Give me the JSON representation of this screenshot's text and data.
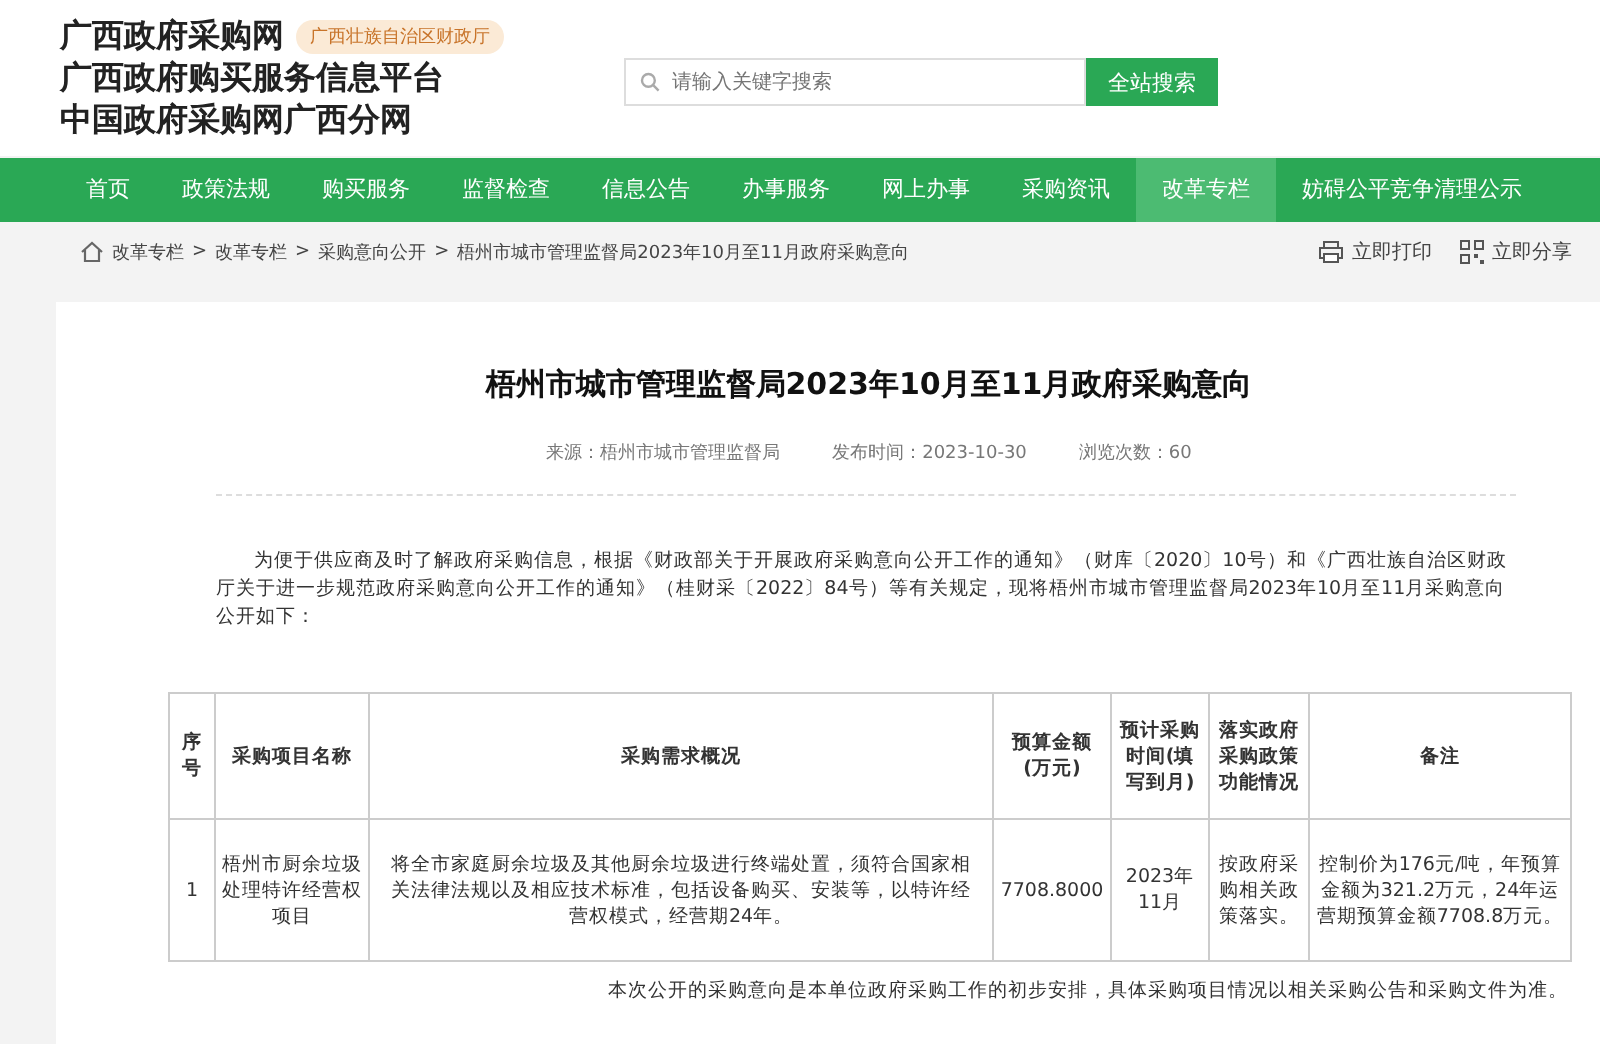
{
  "header": {
    "site_names": [
      "广西政府采购网",
      "广西政府购买服务信息平台",
      "中国政府采购网广西分网"
    ],
    "badge": "广西壮族自治区财政厅",
    "search": {
      "placeholder": "请输入关键字搜索",
      "button": "全站搜索"
    }
  },
  "nav": [
    {
      "label": "首页",
      "selected": false
    },
    {
      "label": "政策法规",
      "selected": false
    },
    {
      "label": "购买服务",
      "selected": false
    },
    {
      "label": "监督检查",
      "selected": false
    },
    {
      "label": "信息公告",
      "selected": false
    },
    {
      "label": "办事服务",
      "selected": false
    },
    {
      "label": "网上办事",
      "selected": false
    },
    {
      "label": "采购资讯",
      "selected": false
    },
    {
      "label": "改革专栏",
      "selected": true
    },
    {
      "label": "妨碍公平竞争清理公示",
      "selected": false
    }
  ],
  "breadcrumb_separator": ">",
  "breadcrumb": [
    "改革专栏",
    "改革专栏",
    "采购意向公开",
    "梧州市城市管理监督局2023年10月至11月政府采购意向"
  ],
  "actions": [
    {
      "kind": "print",
      "label": "立即打印"
    },
    {
      "kind": "share",
      "label": "立即分享"
    }
  ],
  "article": {
    "title": "梧州市城市管理监督局2023年10月至11月政府采购意向",
    "meta": [
      "来源：梧州市城市管理监督局",
      "发布时间：2023-10-30",
      "浏览次数：60"
    ],
    "intro": "为便于供应商及时了解政府采购信息，根据《财政部关于开展政府采购意向公开工作的通知》（财库〔2020〕10号）和《广西壮族自治区财政厅关于进一步规范政府采购意向公开工作的通知》（桂财采〔2022〕84号）等有关规定，现将梧州市城市管理监督局2023年10月至11月采购意向公开如下：",
    "table": {
      "columns": [
        "序号",
        "采购项目名称",
        "采购需求概况",
        "预算金额(万元)",
        "预计采购时间(填写到月)",
        "落实政府采购政策功能情况",
        "备注"
      ],
      "rows": [
        [
          "1",
          "梧州市厨余垃圾处理特许经营权项目",
          "将全市家庭厨余垃圾及其他厨余垃圾进行终端处置，须符合国家相关法律法规以及相应技术标准，包括设备购买、安装等，以特许经营权模式，经营期24年。",
          "7708.8000",
          "2023年11月",
          "按政府采购相关政策落实。",
          "控制价为176元/吨，年预算金额为321.2万元，24年运营期预算金额7708.8万元。"
        ]
      ]
    },
    "footnote": "本次公开的采购意向是本单位政府采购工作的初步安排，具体采购项目情况以相关采购公告和采购文件为准。"
  }
}
